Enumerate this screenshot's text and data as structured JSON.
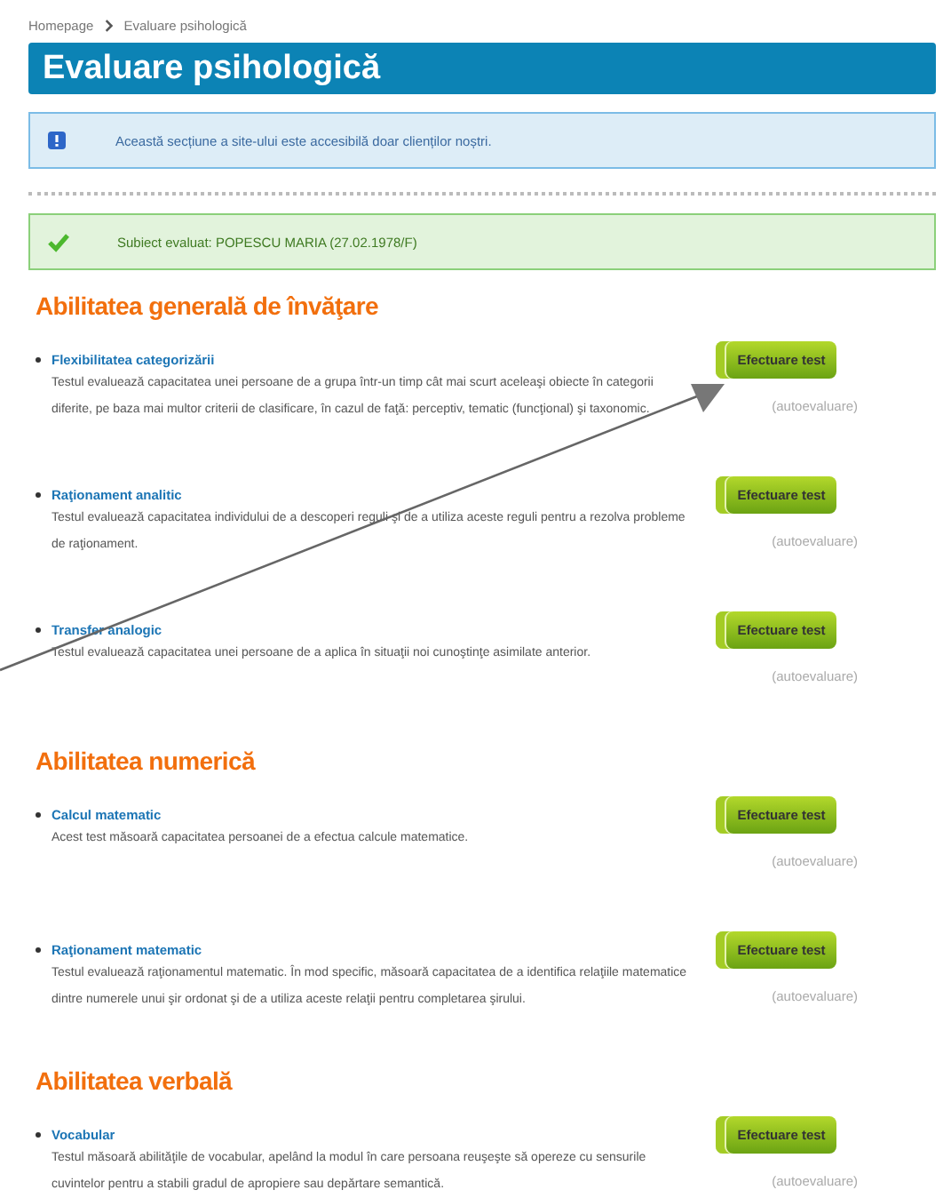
{
  "breadcrumb": [
    {
      "label": "Homepage"
    },
    {
      "label": "Evaluare psihologică"
    }
  ],
  "page_title": "Evaluare psihologică",
  "info_notice": "Această secțiune a site-ului este accesibilă doar clienților noștri.",
  "subject_notice": "Subiect evaluat: POPESCU MARIA (27.02.1978/F)",
  "sections": [
    {
      "heading": "Abilitatea generală de învăţare",
      "tests": [
        {
          "title": "Flexibilitatea categorizării",
          "description": "Testul evaluează capacitatea unei persoane de a grupa într-un timp cât mai scurt aceleaşi obiecte în categorii diferite, pe baza mai multor criterii de clasificare, în cazul de faţă: perceptiv, tematic (funcţional) şi taxonomic.",
          "button": "Efectuare test",
          "note": "(autoevaluare)"
        },
        {
          "title": "Raţionament analitic",
          "description": "Testul evaluează capacitatea individului de a descoperi reguli şi de a utiliza aceste reguli pentru a rezolva probleme de raţionament.",
          "button": "Efectuare test",
          "note": "(autoevaluare)"
        },
        {
          "title": "Transfer analogic",
          "description": "Testul evaluează capacitatea unei persoane de a aplica în situaţii noi cunoştinţe asimilate anterior.",
          "button": "Efectuare test",
          "note": "(autoevaluare)"
        }
      ]
    },
    {
      "heading": "Abilitatea numerică",
      "tests": [
        {
          "title": "Calcul matematic",
          "description": "Acest test măsoară capacitatea persoanei de a efectua calcule matematice.",
          "button": "Efectuare test",
          "note": "(autoevaluare)"
        },
        {
          "title": "Raţionament matematic",
          "description": "Testul evaluează raţionamentul matematic. În mod specific, măsoară capacitatea de a identifica relaţiile matematice dintre numerele unui şir ordonat şi de a utiliza aceste relaţii pentru completarea şirului.",
          "button": "Efectuare test",
          "note": "(autoevaluare)"
        }
      ]
    },
    {
      "heading": "Abilitatea verbală",
      "tests": [
        {
          "title": "Vocabular",
          "description": "Testul măsoară abilităţile de vocabular, apelând la modul în care persoana reuşeşte să opereze cu sensurile cuvintelor pentru a stabili gradul de apropiere sau depărtare semantică.",
          "button": "Efectuare test",
          "note": "(autoevaluare)"
        }
      ]
    }
  ]
}
